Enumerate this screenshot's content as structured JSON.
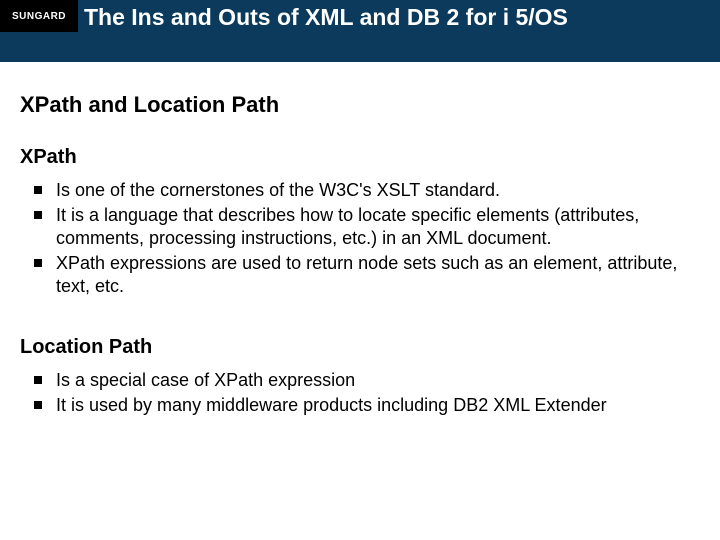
{
  "logo": "SUNGARD",
  "title": "The Ins and Outs of XML and DB 2 for i 5/OS",
  "heading": "XPath and Location Path",
  "sections": [
    {
      "subheading": "XPath",
      "bullets": [
        "Is one of the cornerstones of the W3C's XSLT standard.",
        "It is a language that describes how to locate specific elements (attributes, comments, processing instructions, etc.) in an XML document.",
        "XPath expressions are used to return node sets such as an element, attribute, text, etc."
      ]
    },
    {
      "subheading": "Location Path",
      "bullets": [
        "Is a special case of XPath expression",
        "It is used by many middleware products including DB2 XML Extender"
      ]
    }
  ]
}
